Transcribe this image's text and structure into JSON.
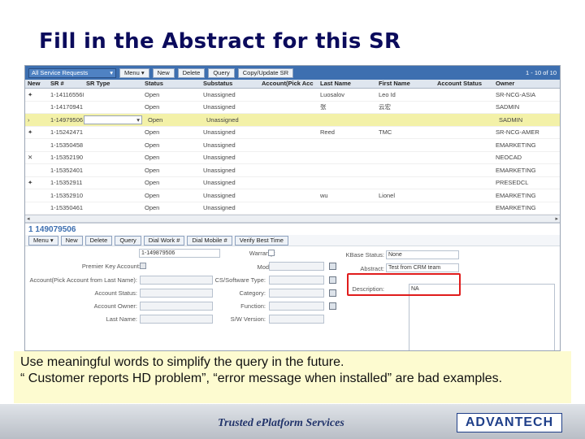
{
  "slide": {
    "title": "Fill in the Abstract for this SR",
    "caption_line1": "Use meaningful words to simplify the query in the future.",
    "caption_line2": "“ Customer reports HD problem”, “error message when installed” are bad examples."
  },
  "list_toolbar": {
    "view_select": "All Service Requests",
    "menu_label": "Menu ▾",
    "new_label": "New",
    "delete_label": "Delete",
    "query_label": "Query",
    "copy_label": "Copy/Update SR",
    "record_count": "1 - 10 of 10"
  },
  "grid": {
    "headers": [
      "New",
      "SR #",
      "SR Type",
      "Status",
      "Substatus",
      "Account(Pick Acc",
      "Last Name",
      "First Name",
      "Account Status",
      "Owner"
    ],
    "rows": [
      {
        "marker": "✦",
        "sr": "1-141165568",
        "type": "",
        "status": "Open",
        "sub": "Unassigned",
        "acct": "",
        "last": "Luosalov",
        "first": "Leo Id",
        "astat": "",
        "owner": "SR-NCG-ASIA"
      },
      {
        "marker": "",
        "sr": "1-14170941",
        "type": "",
        "status": "Open",
        "sub": "Unassigned",
        "acct": "",
        "last": "张",
        "first": "云宏",
        "astat": "",
        "owner": "SADMIN"
      },
      {
        "marker": "›",
        "sr": "1-14979506",
        "type": "",
        "status": "Open",
        "sub": "Unassigned",
        "acct": "",
        "last": "",
        "first": "",
        "astat": "",
        "owner": "SADMIN"
      },
      {
        "marker": "✦",
        "sr": "1-15242471",
        "type": "",
        "status": "Open",
        "sub": "Unassigned",
        "acct": "",
        "last": "Reed",
        "first": "TMC",
        "astat": "",
        "owner": "SR-NCG-AMER"
      },
      {
        "marker": "",
        "sr": "1-15350458",
        "type": "",
        "status": "Open",
        "sub": "Unassigned",
        "acct": "",
        "last": "",
        "first": "",
        "astat": "",
        "owner": "EMARKETING"
      },
      {
        "marker": "✕",
        "sr": "1-15352190",
        "type": "",
        "status": "Open",
        "sub": "Unassigned",
        "acct": "",
        "last": "",
        "first": "",
        "astat": "",
        "owner": "NEOCAD"
      },
      {
        "marker": "",
        "sr": "1-15352401",
        "type": "",
        "status": "Open",
        "sub": "Unassigned",
        "acct": "",
        "last": "",
        "first": "",
        "astat": "",
        "owner": "EMARKETING"
      },
      {
        "marker": "✦",
        "sr": "1-15352911",
        "type": "",
        "status": "Open",
        "sub": "Unassigned",
        "acct": "",
        "last": "",
        "first": "",
        "astat": "",
        "owner": "PRESEDCL"
      },
      {
        "marker": "",
        "sr": "1-15352910",
        "type": "",
        "status": "Open",
        "sub": "Unassigned",
        "acct": "",
        "last": "wu",
        "first": "Lionel",
        "astat": "",
        "owner": "EMARKETING"
      },
      {
        "marker": "",
        "sr": "1-15350461",
        "type": "",
        "status": "Open",
        "sub": "Unassigned",
        "acct": "",
        "last": "",
        "first": "",
        "astat": "",
        "owner": "EMARKETING"
      }
    ]
  },
  "form": {
    "record_title": "1 149079506",
    "buttons": [
      "Menu ▾",
      "New",
      "Delete",
      "Query",
      "Dial Work #",
      "Dial Mobile #",
      "Verify Best Time"
    ],
    "sr_label": "SR #:",
    "sr_value": "1-149879506",
    "warranty_label": "Warranty:",
    "kbase_label": "KBase Status:",
    "kbase_value": "None",
    "premier_label": "Premier Key Account:",
    "model_label": "Model:",
    "abstract_label": "Abstract:",
    "abstract_value": "Test from CRM team",
    "acct_pick_label": "Account(Pick Account from Last Name):",
    "cs_sw_label": "CS/Software Type:",
    "description_label": "Description:",
    "description_value": "NA",
    "acct_status_label": "Account Status:",
    "category_label": "Category:",
    "acct_owner_label": "Account Owner:",
    "function_label": "Function:",
    "last_name_label": "Last Name:",
    "sw_version_label": "S/W Version:"
  },
  "footer": {
    "tagline": "Trusted ePlatform Services",
    "logo": "ADVANTECH"
  },
  "colors": {
    "title": "#0b0b5c",
    "toolbar": "#3d6fb0",
    "highlight": "#e01c1c",
    "selected_row": "#f3f1a8"
  }
}
